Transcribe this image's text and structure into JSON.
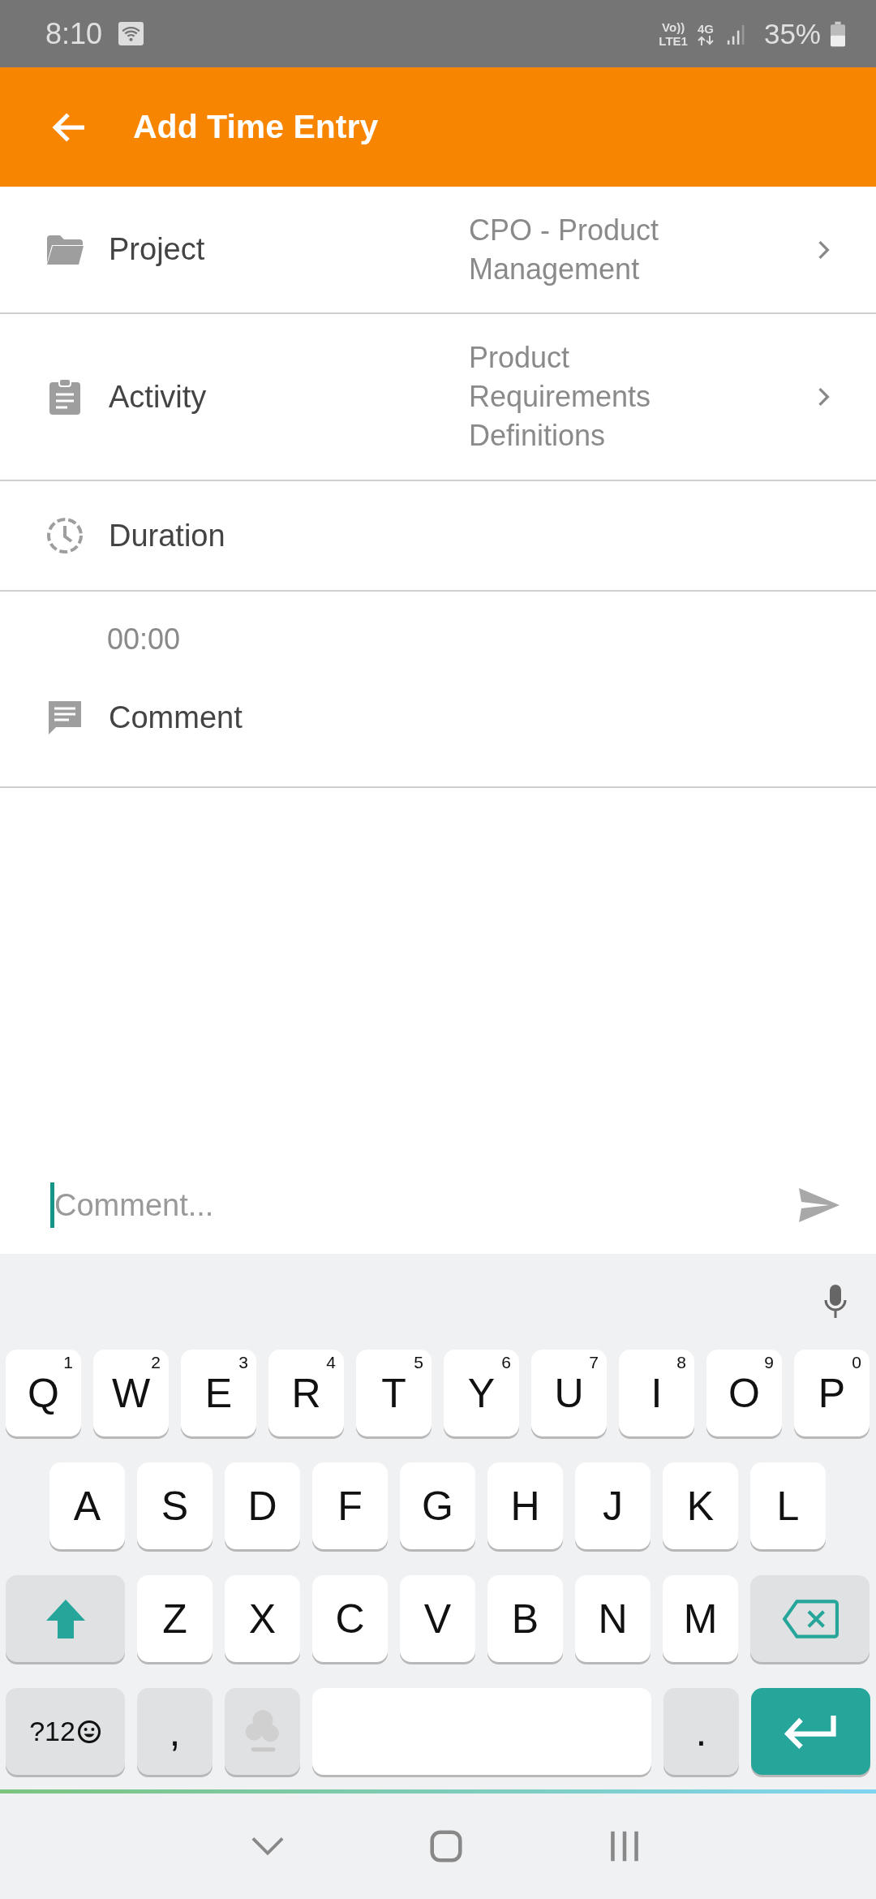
{
  "status_bar": {
    "time": "8:10",
    "volte_top": "Vo))",
    "volte_bottom": "LTE1",
    "network": "4G",
    "battery": "35%"
  },
  "app_bar": {
    "title": "Add Time Entry"
  },
  "fields": [
    {
      "kind": "select",
      "label": "Project",
      "value": "CPO - Product Management"
    },
    {
      "kind": "select",
      "label": "Activity",
      "value": "Product Requirements Definitions"
    },
    {
      "kind": "heading",
      "label": "Duration"
    },
    {
      "kind": "value",
      "value": "00:00"
    },
    {
      "kind": "heading",
      "label": "Comment"
    }
  ],
  "comment_input": {
    "placeholder": "Comment..."
  },
  "keyboard": {
    "key_rows": [
      [
        {
          "kind": "char",
          "label": "Q",
          "hint": "1"
        },
        {
          "kind": "char",
          "label": "W",
          "hint": "2"
        },
        {
          "kind": "char",
          "label": "E",
          "hint": "3"
        },
        {
          "kind": "char",
          "label": "R",
          "hint": "4"
        },
        {
          "kind": "char",
          "label": "T",
          "hint": "5"
        },
        {
          "kind": "char",
          "label": "Y",
          "hint": "6"
        },
        {
          "kind": "char",
          "label": "U",
          "hint": "7"
        },
        {
          "kind": "char",
          "label": "I",
          "hint": "8"
        },
        {
          "kind": "char",
          "label": "O",
          "hint": "9"
        },
        {
          "kind": "char",
          "label": "P",
          "hint": "0"
        }
      ],
      [
        {
          "kind": "char",
          "label": "A"
        },
        {
          "kind": "char",
          "label": "S"
        },
        {
          "kind": "char",
          "label": "D"
        },
        {
          "kind": "char",
          "label": "F"
        },
        {
          "kind": "char",
          "label": "G"
        },
        {
          "kind": "char",
          "label": "H"
        },
        {
          "kind": "char",
          "label": "J"
        },
        {
          "kind": "char",
          "label": "K"
        },
        {
          "kind": "char",
          "label": "L"
        }
      ],
      [
        {
          "kind": "shift"
        },
        {
          "kind": "char",
          "label": "Z"
        },
        {
          "kind": "char",
          "label": "X"
        },
        {
          "kind": "char",
          "label": "C"
        },
        {
          "kind": "char",
          "label": "V"
        },
        {
          "kind": "char",
          "label": "B"
        },
        {
          "kind": "char",
          "label": "N"
        },
        {
          "kind": "char",
          "label": "M"
        },
        {
          "kind": "backspace"
        }
      ],
      [
        {
          "kind": "symbols",
          "label": "?12"
        },
        {
          "kind": "punct",
          "label": ","
        },
        {
          "kind": "sticker"
        },
        {
          "kind": "space"
        },
        {
          "kind": "punct",
          "label": "."
        },
        {
          "kind": "enter"
        }
      ]
    ]
  }
}
